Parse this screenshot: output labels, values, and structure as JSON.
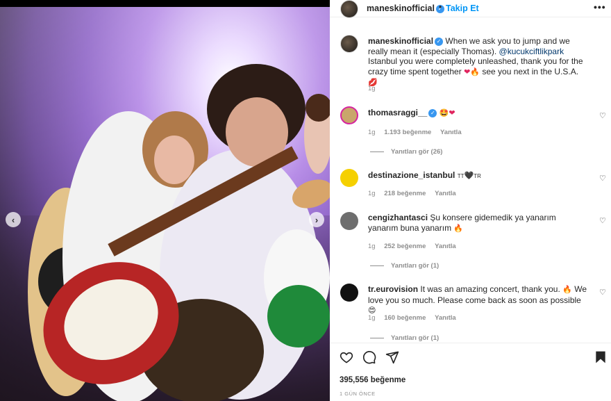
{
  "post": {
    "username": "maneskinofficial",
    "follow_label": "Takip Et",
    "caption_user": "maneskinofficial",
    "caption_before_mention": "When we ask you to jump and we really mean it (especially Thomas).",
    "caption_mention": "@kucukciftlikpark",
    "caption_after_mention": "Istanbul you were completely unleashed, thank you for the crazy time spent together",
    "caption_after_emoji": "see you next in the U.S.A.",
    "caption_time": "1g"
  },
  "comments": [
    {
      "user": "thomasraggi__",
      "text": "",
      "time": "1g",
      "likes": "1.193 beğenme",
      "reply": "Yanıtla",
      "view_replies": "Yanıtları gör (26)"
    },
    {
      "user": "destinazione_istanbul",
      "text": "TT",
      "text2": "TR",
      "time": "1g",
      "likes": "218 beğenme",
      "reply": "Yanıtla"
    },
    {
      "user": "cengizhantasci",
      "text": "Şu konsere gidemedik ya yanarım yanarım buna yanarım",
      "time": "1g",
      "likes": "252 beğenme",
      "reply": "Yanıtla",
      "view_replies": "Yanıtları gör (1)"
    },
    {
      "user": "tr.eurovision",
      "text": "It was an amazing concert, thank you.",
      "text2": "We love you so much. Please come back as soon as possible",
      "time": "1g",
      "likes": "160 beğenme",
      "reply": "Yanıtla",
      "view_replies": "Yanıtları gör (1)"
    }
  ],
  "footer": {
    "likes": "395,556 beğenme",
    "time": "1 GÜN ÖNCE"
  },
  "icons": [
    "heart-icon",
    "comment-icon",
    "share-icon",
    "bookmark-icon",
    "more-icon",
    "verified-icon",
    "chevron-left-icon",
    "chevron-right-icon"
  ],
  "colors": {
    "accent": "#0095f6",
    "verified": "#3897f0",
    "muted": "#8e8e8e"
  }
}
